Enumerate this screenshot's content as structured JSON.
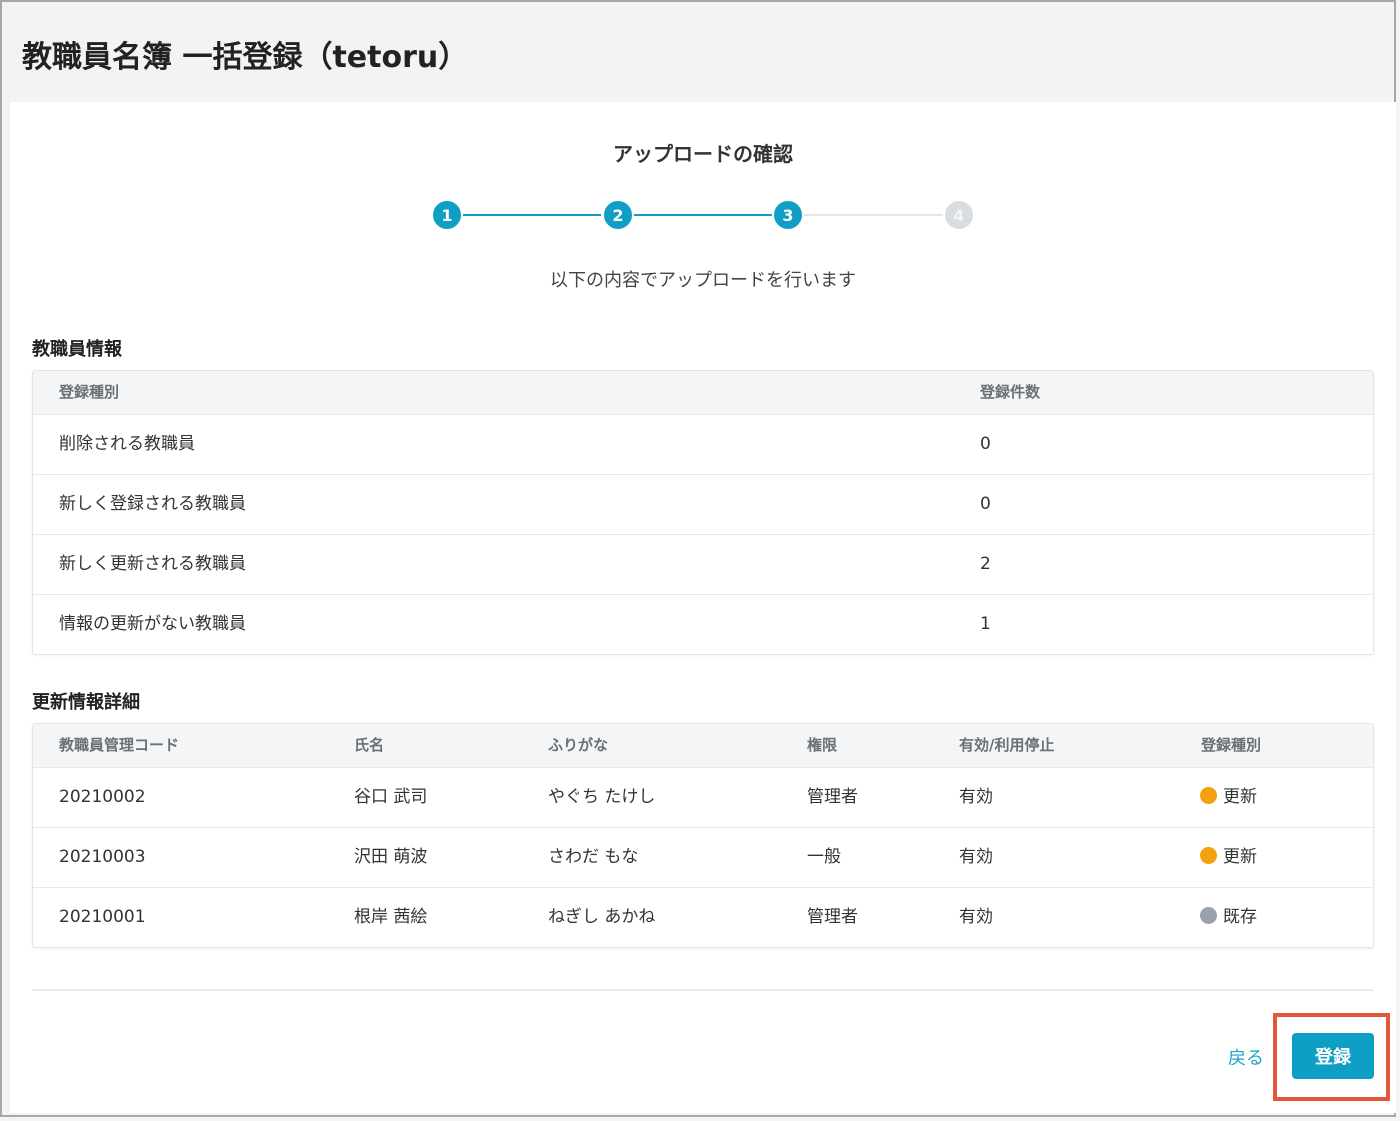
{
  "header": {
    "title": "教職員名簿 一括登録（tetoru）"
  },
  "wizard": {
    "title": "アップロードの確認",
    "description": "以下の内容でアップロードを行います",
    "steps": [
      {
        "label": "1",
        "status": "complete"
      },
      {
        "label": "2",
        "status": "complete"
      },
      {
        "label": "3",
        "status": "current"
      },
      {
        "label": "4",
        "status": "pending"
      }
    ]
  },
  "summary": {
    "title": "教職員情報",
    "columns": [
      "登録種別",
      "登録件数"
    ],
    "rows": [
      {
        "type": "削除される教職員",
        "count": "0"
      },
      {
        "type": "新しく登録される教職員",
        "count": "0"
      },
      {
        "type": "新しく更新される教職員",
        "count": "2"
      },
      {
        "type": "情報の更新がない教職員",
        "count": "1"
      }
    ]
  },
  "details": {
    "title": "更新情報詳細",
    "columns": [
      "教職員管理コード",
      "氏名",
      "ふりがな",
      "権限",
      "有効/利用停止",
      "登録種別"
    ],
    "rows": [
      {
        "code": "20210002",
        "name": "谷口 武司",
        "kana": "やぐち たけし",
        "role": "管理者",
        "status": "有効",
        "type": "更新",
        "type_color": "#f5a10f"
      },
      {
        "code": "20210003",
        "name": "沢田 萌波",
        "kana": "さわだ もな",
        "role": "一般",
        "status": "有効",
        "type": "更新",
        "type_color": "#f5a10f"
      },
      {
        "code": "20210001",
        "name": "根岸 茜絵",
        "kana": "ねぎし あかね",
        "role": "管理者",
        "status": "有効",
        "type": "既存",
        "type_color": "#9aa1ae"
      }
    ]
  },
  "footer": {
    "back_label": "戻る",
    "submit_label": "登録"
  },
  "colors": {
    "accent": "#1aa6c8",
    "step_active": "#0f9fc4",
    "step_pending": "#d9dce1",
    "line_pending": "#e3e5e9",
    "highlight": "#e2563a"
  }
}
